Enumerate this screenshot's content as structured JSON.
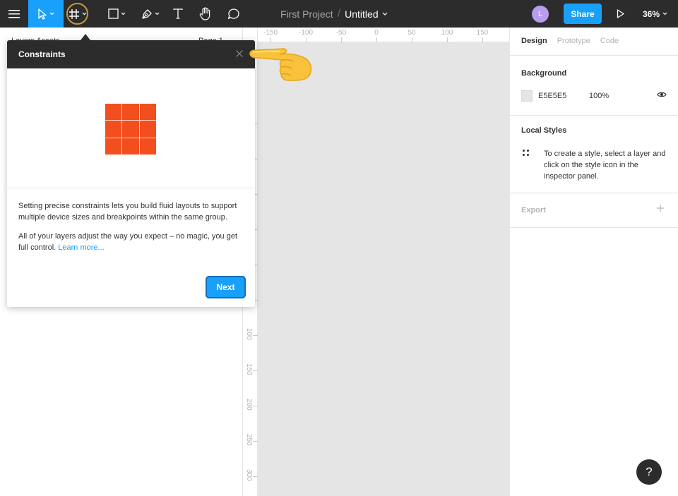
{
  "toolbar": {
    "project_name": "First Project",
    "separator": "/",
    "file_name": "Untitled",
    "avatar_initial": "L",
    "share_label": "Share",
    "zoom": "36%"
  },
  "left_panel": {
    "tabs_text": "Layers   Assets",
    "page_label": "Page 1"
  },
  "ruler": {
    "horizontal": [
      "-150",
      "-100",
      "-50",
      "0",
      "50",
      "100",
      "150"
    ],
    "vertical": [
      "100",
      "150",
      "200",
      "250",
      "300"
    ]
  },
  "canvas": {
    "background": "#E5E5E5"
  },
  "right_panel": {
    "tabs": [
      "Design",
      "Prototype",
      "Code"
    ],
    "background_title": "Background",
    "background_hex": "E5E5E5",
    "background_opacity": "100%",
    "local_styles_title": "Local Styles",
    "local_styles_text": "To create a style, select a layer and click on the style icon in the inspector panel.",
    "export_title": "Export"
  },
  "popup": {
    "title": "Constraints",
    "paragraph1": "Setting precise constraints lets you build fluid layouts to support multiple device sizes and breakpoints within the same group.",
    "paragraph2": "All of your layers adjust the way you expect – no magic, you get full control. ",
    "link_text": "Learn more...",
    "next_label": "Next"
  },
  "help": {
    "label": "?"
  },
  "colors": {
    "accent": "#18A0FB",
    "toolbar_bg": "#2C2C2C",
    "illustration": "#F24E1E"
  },
  "icons": [
    "menu-icon",
    "move-tool-icon",
    "frame-tool-icon",
    "shape-tool-icon",
    "pen-tool-icon",
    "text-tool-icon",
    "hand-tool-icon",
    "comment-icon",
    "play-icon",
    "eye-icon",
    "styles-icon",
    "plus-icon",
    "close-icon",
    "pointing-hand-icon"
  ]
}
